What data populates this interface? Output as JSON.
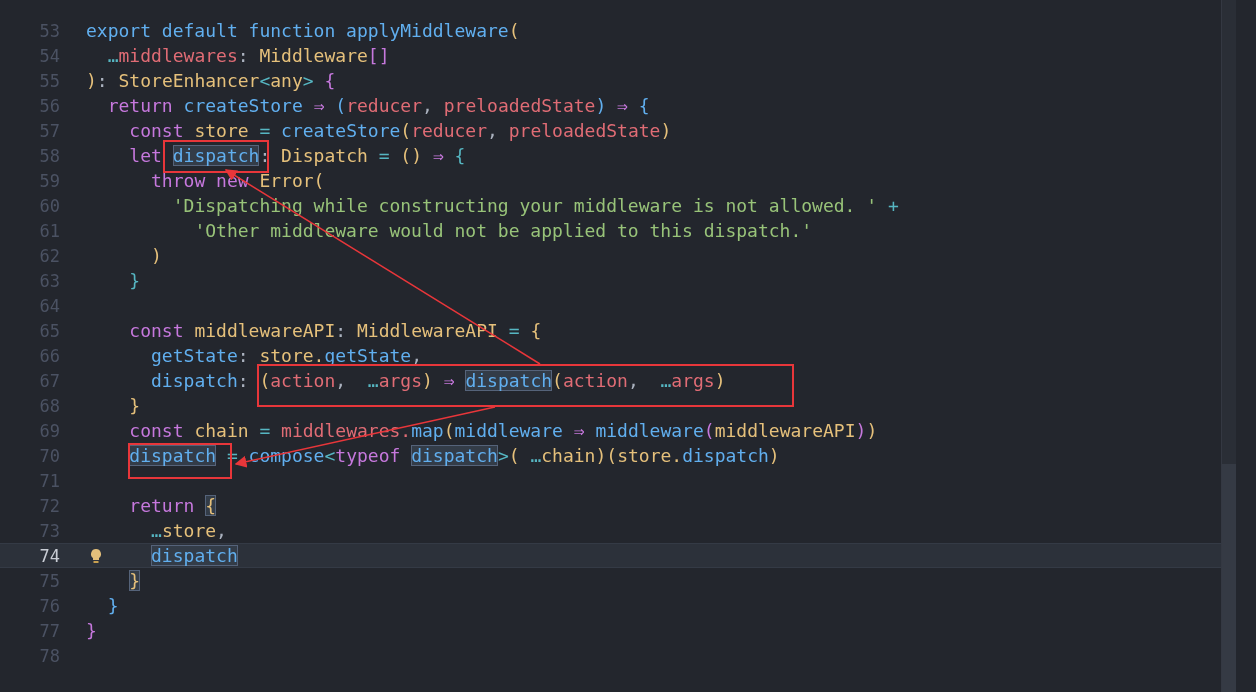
{
  "editor": {
    "lines": [
      {
        "number": "53",
        "current": false,
        "tokens": [
          {
            "t": "export default function applyMiddleware",
            "color": "#61afef"
          },
          {
            "t": "(",
            "color": "#e5c07b"
          }
        ]
      },
      {
        "number": "54",
        "current": false,
        "tokens": [
          {
            "t": "  …",
            "color": "#56b6c2"
          },
          {
            "t": "middlewares",
            "color": "#e06c75"
          },
          {
            "t": ": ",
            "color": "#abb2bf"
          },
          {
            "t": "Middleware",
            "color": "#e5c07b"
          },
          {
            "t": "[]",
            "color": "#c678dd"
          }
        ]
      },
      {
        "number": "55",
        "current": false,
        "tokens": [
          {
            "t": ")",
            "color": "#e5c07b"
          },
          {
            "t": ": ",
            "color": "#abb2bf"
          },
          {
            "t": "StoreEnhancer",
            "color": "#e5c07b"
          },
          {
            "t": "<",
            "color": "#56b6c2"
          },
          {
            "t": "any",
            "color": "#e5c07b"
          },
          {
            "t": ">",
            "color": "#56b6c2"
          },
          {
            "t": " {",
            "color": "#c678dd"
          }
        ]
      },
      {
        "number": "56",
        "current": false,
        "tokens": [
          {
            "t": "  return",
            "color": "#c678dd"
          },
          {
            "t": " createStore",
            "color": "#61afef"
          },
          {
            "t": " ⇒ ",
            "color": "#c678dd"
          },
          {
            "t": "(",
            "color": "#61afef"
          },
          {
            "t": "reducer",
            "color": "#e06c75"
          },
          {
            "t": ", ",
            "color": "#abb2bf"
          },
          {
            "t": "preloadedState",
            "color": "#e06c75"
          },
          {
            "t": ")",
            "color": "#61afef"
          },
          {
            "t": " ⇒ ",
            "color": "#c678dd"
          },
          {
            "t": "{",
            "color": "#61afef"
          }
        ]
      },
      {
        "number": "57",
        "current": false,
        "tokens": [
          {
            "t": "    const",
            "color": "#c678dd"
          },
          {
            "t": " store",
            "color": "#e5c07b"
          },
          {
            "t": " = ",
            "color": "#56b6c2"
          },
          {
            "t": "createStore",
            "color": "#61afef"
          },
          {
            "t": "(",
            "color": "#e5c07b"
          },
          {
            "t": "reducer",
            "color": "#e06c75"
          },
          {
            "t": ", ",
            "color": "#abb2bf"
          },
          {
            "t": "preloadedState",
            "color": "#e06c75"
          },
          {
            "t": ")",
            "color": "#e5c07b"
          }
        ]
      },
      {
        "number": "58",
        "current": false,
        "tokens": [
          {
            "t": "    let",
            "color": "#c678dd"
          },
          {
            "t": " dispatch",
            "color": "#61afef",
            "highlighted": true
          },
          {
            "t": ": ",
            "color": "#abb2bf"
          },
          {
            "t": "Dispatch",
            "color": "#e5c07b"
          },
          {
            "t": " = ",
            "color": "#56b6c2"
          },
          {
            "t": "()",
            "color": "#e5c07b"
          },
          {
            "t": " ⇒ ",
            "color": "#c678dd"
          },
          {
            "t": "{",
            "color": "#56b6c2"
          }
        ]
      },
      {
        "number": "59",
        "current": false,
        "tokens": [
          {
            "t": "      throw new",
            "color": "#c678dd"
          },
          {
            "t": " Error",
            "color": "#e5c07b"
          },
          {
            "t": "(",
            "color": "#e5c07b"
          }
        ]
      },
      {
        "number": "60",
        "current": false,
        "tokens": [
          {
            "t": "        'Dispatching while constructing your middleware is not allowed. '",
            "color": "#98c379"
          },
          {
            "t": " +",
            "color": "#56b6c2"
          }
        ]
      },
      {
        "number": "61",
        "current": false,
        "tokens": [
          {
            "t": "          'Other middleware would not be applied to this dispatch.'",
            "color": "#98c379"
          }
        ]
      },
      {
        "number": "62",
        "current": false,
        "tokens": [
          {
            "t": "      )",
            "color": "#e5c07b"
          }
        ]
      },
      {
        "number": "63",
        "current": false,
        "tokens": [
          {
            "t": "    }",
            "color": "#56b6c2"
          }
        ]
      },
      {
        "number": "64",
        "current": false
      },
      {
        "number": "65",
        "current": false,
        "tokens": [
          {
            "t": "    const",
            "color": "#c678dd"
          },
          {
            "t": " middlewareAPI",
            "color": "#e5c07b"
          },
          {
            "t": ": ",
            "color": "#abb2bf"
          },
          {
            "t": "MiddlewareAPI",
            "color": "#e5c07b"
          },
          {
            "t": " = ",
            "color": "#56b6c2"
          },
          {
            "t": "{",
            "color": "#e5c07b"
          }
        ]
      },
      {
        "number": "66",
        "current": false,
        "tokens": [
          {
            "t": "      getState",
            "color": "#61afef"
          },
          {
            "t": ": ",
            "color": "#abb2bf"
          },
          {
            "t": "store.",
            "color": "#e5c07b"
          },
          {
            "t": "getState",
            "color": "#61afef"
          },
          {
            "t": ",",
            "color": "#abb2bf"
          }
        ]
      },
      {
        "number": "67",
        "current": false,
        "tokens": [
          {
            "t": "      dispatch",
            "color": "#61afef"
          },
          {
            "t": ": ",
            "color": "#abb2bf"
          },
          {
            "t": "(",
            "color": "#e5c07b"
          },
          {
            "t": "action",
            "color": "#e06c75"
          },
          {
            "t": ",  ",
            "color": "#abb2bf"
          },
          {
            "t": "…",
            "color": "#56b6c2"
          },
          {
            "t": "args",
            "color": "#e06c75"
          },
          {
            "t": ")",
            "color": "#e5c07b"
          },
          {
            "t": " ⇒ ",
            "color": "#c678dd"
          },
          {
            "t": "dispatch",
            "color": "#61afef",
            "highlighted": true
          },
          {
            "t": "(",
            "color": "#e5c07b"
          },
          {
            "t": "action",
            "color": "#e06c75"
          },
          {
            "t": ",  ",
            "color": "#abb2bf"
          },
          {
            "t": "…",
            "color": "#56b6c2"
          },
          {
            "t": "args",
            "color": "#e06c75"
          },
          {
            "t": ")",
            "color": "#e5c07b"
          }
        ]
      },
      {
        "number": "68",
        "current": false,
        "tokens": [
          {
            "t": "    }",
            "color": "#e5c07b"
          }
        ]
      },
      {
        "number": "69",
        "current": false,
        "tokens": [
          {
            "t": "    const",
            "color": "#c678dd"
          },
          {
            "t": " chain",
            "color": "#e5c07b"
          },
          {
            "t": " = ",
            "color": "#56b6c2"
          },
          {
            "t": "middlewares.",
            "color": "#e06c75"
          },
          {
            "t": "map",
            "color": "#61afef"
          },
          {
            "t": "(",
            "color": "#e5c07b"
          },
          {
            "t": "middleware",
            "color": "#61afef"
          },
          {
            "t": " ⇒ ",
            "color": "#c678dd"
          },
          {
            "t": "middleware",
            "color": "#61afef"
          },
          {
            "t": "(",
            "color": "#c678dd"
          },
          {
            "t": "middlewareAPI",
            "color": "#e5c07b"
          },
          {
            "t": ")",
            "color": "#c678dd"
          },
          {
            "t": ")",
            "color": "#e5c07b"
          }
        ]
      },
      {
        "number": "70",
        "current": false,
        "tokens": [
          {
            "t": "    dispatch",
            "color": "#61afef",
            "highlighted": true
          },
          {
            "t": " = ",
            "color": "#56b6c2"
          },
          {
            "t": "compose",
            "color": "#61afef"
          },
          {
            "t": "<",
            "color": "#56b6c2"
          },
          {
            "t": "typeof",
            "color": "#c678dd"
          },
          {
            "t": " dispatch",
            "color": "#61afef",
            "highlighted": true
          },
          {
            "t": ">",
            "color": "#56b6c2"
          },
          {
            "t": "(",
            "color": "#e5c07b"
          },
          {
            "t": " …",
            "color": "#56b6c2"
          },
          {
            "t": "chain",
            "color": "#e5c07b"
          },
          {
            "t": ")(",
            "color": "#e5c07b"
          },
          {
            "t": "store.",
            "color": "#e5c07b"
          },
          {
            "t": "dispatch",
            "color": "#61afef"
          },
          {
            "t": ")",
            "color": "#e5c07b"
          }
        ]
      },
      {
        "number": "71",
        "current": false
      },
      {
        "number": "72",
        "current": false,
        "tokens": [
          {
            "t": "    return",
            "color": "#c678dd"
          },
          {
            "t": " {",
            "color": "#e5c07b",
            "highlighted": true
          }
        ]
      },
      {
        "number": "73",
        "current": false,
        "tokens": [
          {
            "t": "      …",
            "color": "#56b6c2"
          },
          {
            "t": "store",
            "color": "#e5c07b"
          },
          {
            "t": ",",
            "color": "#abb2bf"
          }
        ]
      },
      {
        "number": "74",
        "current": true,
        "lightbulb": true,
        "tokens": [
          {
            "t": "      dispatch",
            "color": "#61afef",
            "highlighted": true
          }
        ]
      },
      {
        "number": "75",
        "current": false,
        "tokens": [
          {
            "t": "    }",
            "color": "#e5c07b",
            "highlighted": true
          }
        ]
      },
      {
        "number": "76",
        "current": false,
        "tokens": [
          {
            "t": "  }",
            "color": "#61afef"
          }
        ]
      },
      {
        "number": "77",
        "current": false,
        "tokens": [
          {
            "t": "}",
            "color": "#c678dd"
          }
        ]
      },
      {
        "number": "78",
        "current": false
      }
    ]
  }
}
